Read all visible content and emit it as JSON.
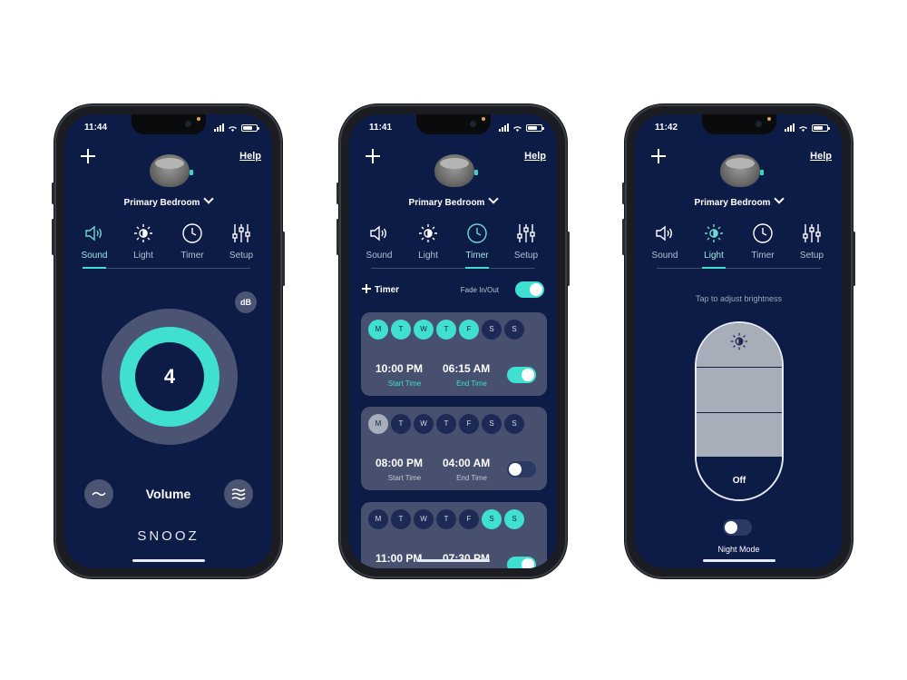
{
  "common": {
    "room": "Primary Bedroom",
    "help": "Help",
    "tabs": [
      "Sound",
      "Light",
      "Timer",
      "Setup"
    ]
  },
  "phones": [
    {
      "time": "11:44",
      "active_tab": "Sound"
    },
    {
      "time": "11:41",
      "active_tab": "Timer"
    },
    {
      "time": "11:42",
      "active_tab": "Light"
    }
  ],
  "sound": {
    "db_label": "dB",
    "volume_value": "4",
    "volume_label": "Volume",
    "logo": "SNOOZ"
  },
  "timer": {
    "add_label": "Timer",
    "fade_label": "Fade In/Out",
    "fade_on": true,
    "day_letters": [
      "M",
      "T",
      "W",
      "T",
      "F",
      "S",
      "S"
    ],
    "schedules": [
      {
        "selected": [
          0,
          1,
          2,
          3,
          4
        ],
        "start": "10:00 PM",
        "end": "06:15 AM",
        "start_label": "Start Time",
        "end_label": "End Time",
        "enabled": true
      },
      {
        "selected": [
          0
        ],
        "start": "08:00 PM",
        "end": "04:00 AM",
        "start_label": "Start Time",
        "end_label": "End Time",
        "enabled": false
      },
      {
        "selected": [
          5,
          6
        ],
        "start": "11:00 PM",
        "end": "07:30 PM",
        "enabled": true
      }
    ]
  },
  "light": {
    "hint": "Tap to adjust brightness",
    "off_label": "Off",
    "night_mode_label": "Night Mode",
    "night_mode_on": false
  },
  "colors": {
    "background": "#0d1b47",
    "accent": "#3fe0d0",
    "card": "#47506f"
  }
}
